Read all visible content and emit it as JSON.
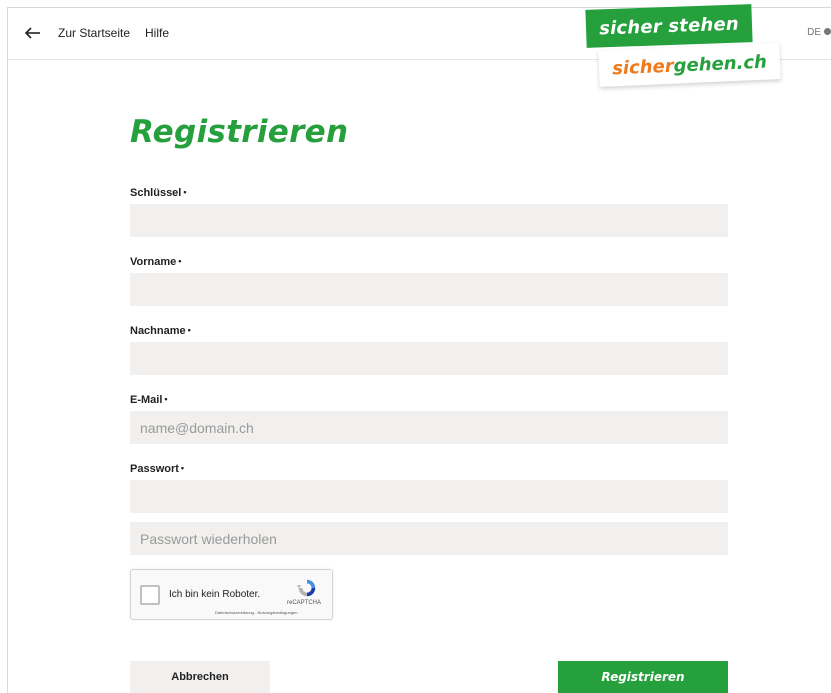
{
  "header": {
    "nav": {
      "home_label": "Zur Startseite",
      "help_label": "Hilfe"
    },
    "language": "DE",
    "logo": {
      "top_text": "sicher stehen",
      "bottom_text_orange": "sicher",
      "bottom_text_green": "gehen.ch"
    }
  },
  "main": {
    "title": "Registrieren",
    "fields": {
      "key": {
        "label": "Schlüssel",
        "required_mark": "•",
        "value": "",
        "placeholder": ""
      },
      "firstname": {
        "label": "Vorname",
        "required_mark": "•",
        "value": "",
        "placeholder": ""
      },
      "lastname": {
        "label": "Nachname",
        "required_mark": "•",
        "value": "",
        "placeholder": ""
      },
      "email": {
        "label": "E-Mail",
        "required_mark": "•",
        "value": "",
        "placeholder": "name@domain.ch"
      },
      "password": {
        "label": "Passwort",
        "required_mark": "•",
        "value": "",
        "placeholder": ""
      },
      "password_repeat": {
        "value": "",
        "placeholder": "Passwort wiederholen"
      }
    },
    "captcha": {
      "label": "Ich bin kein Roboter.",
      "brand": "reCAPTCHA",
      "terms": "Datenschutzerklärung - Nutzungsbedingungen",
      "checked": false
    },
    "actions": {
      "cancel_label": "Abbrechen",
      "submit_label": "Registrieren"
    }
  },
  "colors": {
    "brand_green": "#25a03c",
    "brand_orange": "#ef7a1a",
    "input_bg": "#f1f0ee"
  },
  "icons": {
    "back": "arrow-left-icon",
    "language": "circle-icon",
    "captcha": "recaptcha-icon"
  }
}
